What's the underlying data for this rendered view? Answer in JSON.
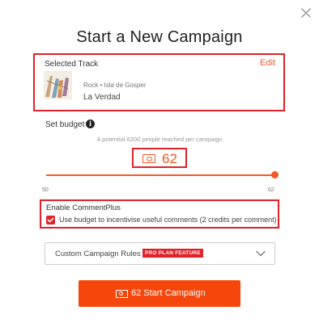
{
  "modal": {
    "title": "Start a New Campaign"
  },
  "track": {
    "section_label": "Selected Track",
    "edit_label": "Edit",
    "meta": "Rock • Isla de Gosper",
    "name": "La Verdad",
    "artwork_icon": "album-artwork"
  },
  "budget": {
    "label": "Set budget",
    "info_glyph": "i",
    "reach_text": "A potential 6200 people reached per campaign",
    "amount": "62",
    "min_label": "50",
    "max_label": "62",
    "slider_level": 1.0
  },
  "comment_plus": {
    "label": "Enable CommentPlus",
    "checkbox_checked": true,
    "checkbox_label": "Use budget to incentivise useful comments (2 credits per comment)"
  },
  "rules": {
    "label": "Custom Campaign Rules",
    "badge": "PRO PLAN FEATURE"
  },
  "cta": {
    "label": "62 Start Campaign"
  },
  "colors": {
    "accent": "#f25a25",
    "highlight": "#e0222a",
    "button": "#f5470c"
  }
}
